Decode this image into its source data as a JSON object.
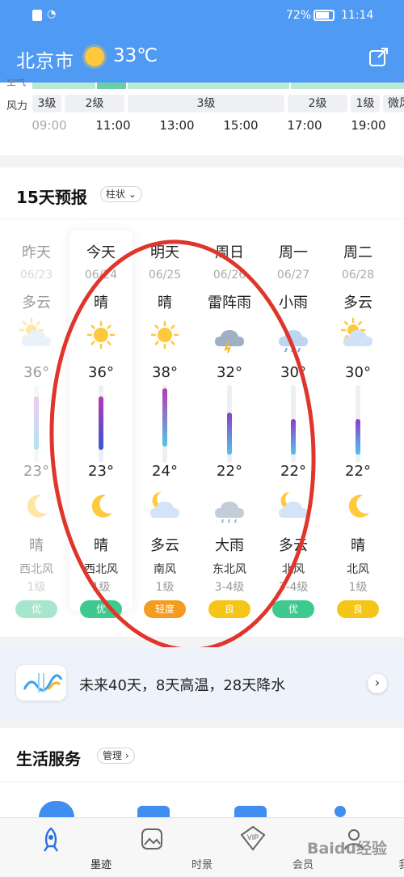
{
  "status_bar": {
    "battery": "72%",
    "time": "11:14"
  },
  "header": {
    "city": "北京市",
    "temp": "33℃"
  },
  "hourly": {
    "air_label": "空气",
    "wind_label": "风力",
    "wind_levels": [
      "3级",
      "2级",
      "3级",
      "2级",
      "1级",
      "微风"
    ],
    "times": [
      "09:00",
      "11:00",
      "13:00",
      "15:00",
      "17:00",
      "19:00"
    ]
  },
  "forecast": {
    "title": "15天预报",
    "view_chip": "柱状",
    "days": [
      {
        "day": "昨天",
        "date": "06/23",
        "cond": "多云",
        "hi": "36°",
        "lo": "23°",
        "night_cond": "晴",
        "wind_dir": "西北风",
        "wind_lv": "1级",
        "aqi": "优"
      },
      {
        "day": "今天",
        "date": "06/24",
        "cond": "晴",
        "hi": "36°",
        "lo": "23°",
        "night_cond": "晴",
        "wind_dir": "西北风",
        "wind_lv": "1级",
        "aqi": "优"
      },
      {
        "day": "明天",
        "date": "06/25",
        "cond": "晴",
        "hi": "38°",
        "lo": "24°",
        "night_cond": "多云",
        "wind_dir": "南风",
        "wind_lv": "1级",
        "aqi": "轻度"
      },
      {
        "day": "周日",
        "date": "06/26",
        "cond": "雷阵雨",
        "hi": "32°",
        "lo": "22°",
        "night_cond": "大雨",
        "wind_dir": "东北风",
        "wind_lv": "3-4级",
        "aqi": "良"
      },
      {
        "day": "周一",
        "date": "06/27",
        "cond": "小雨",
        "hi": "30°",
        "lo": "22°",
        "night_cond": "多云",
        "wind_dir": "北风",
        "wind_lv": "3-4级",
        "aqi": "优"
      },
      {
        "day": "周二",
        "date": "06/28",
        "cond": "多云",
        "hi": "30°",
        "lo": "22°",
        "night_cond": "晴",
        "wind_dir": "北风",
        "wind_lv": "1级",
        "aqi": "良"
      }
    ]
  },
  "promo": {
    "text": "未来40天，8天高温，28天降水"
  },
  "services": {
    "title": "生活服务",
    "manage_chip": "管理"
  },
  "tabs": [
    "墨迹",
    "时景",
    "会员",
    "我"
  ],
  "watermark": "Baidu经验",
  "colors": {
    "header": "#4f9bf3",
    "aqi_good": "#3ec98f",
    "aqi_light": "#f39c1f",
    "aqi_fair": "#f5c518",
    "annotation": "#e0352c"
  }
}
